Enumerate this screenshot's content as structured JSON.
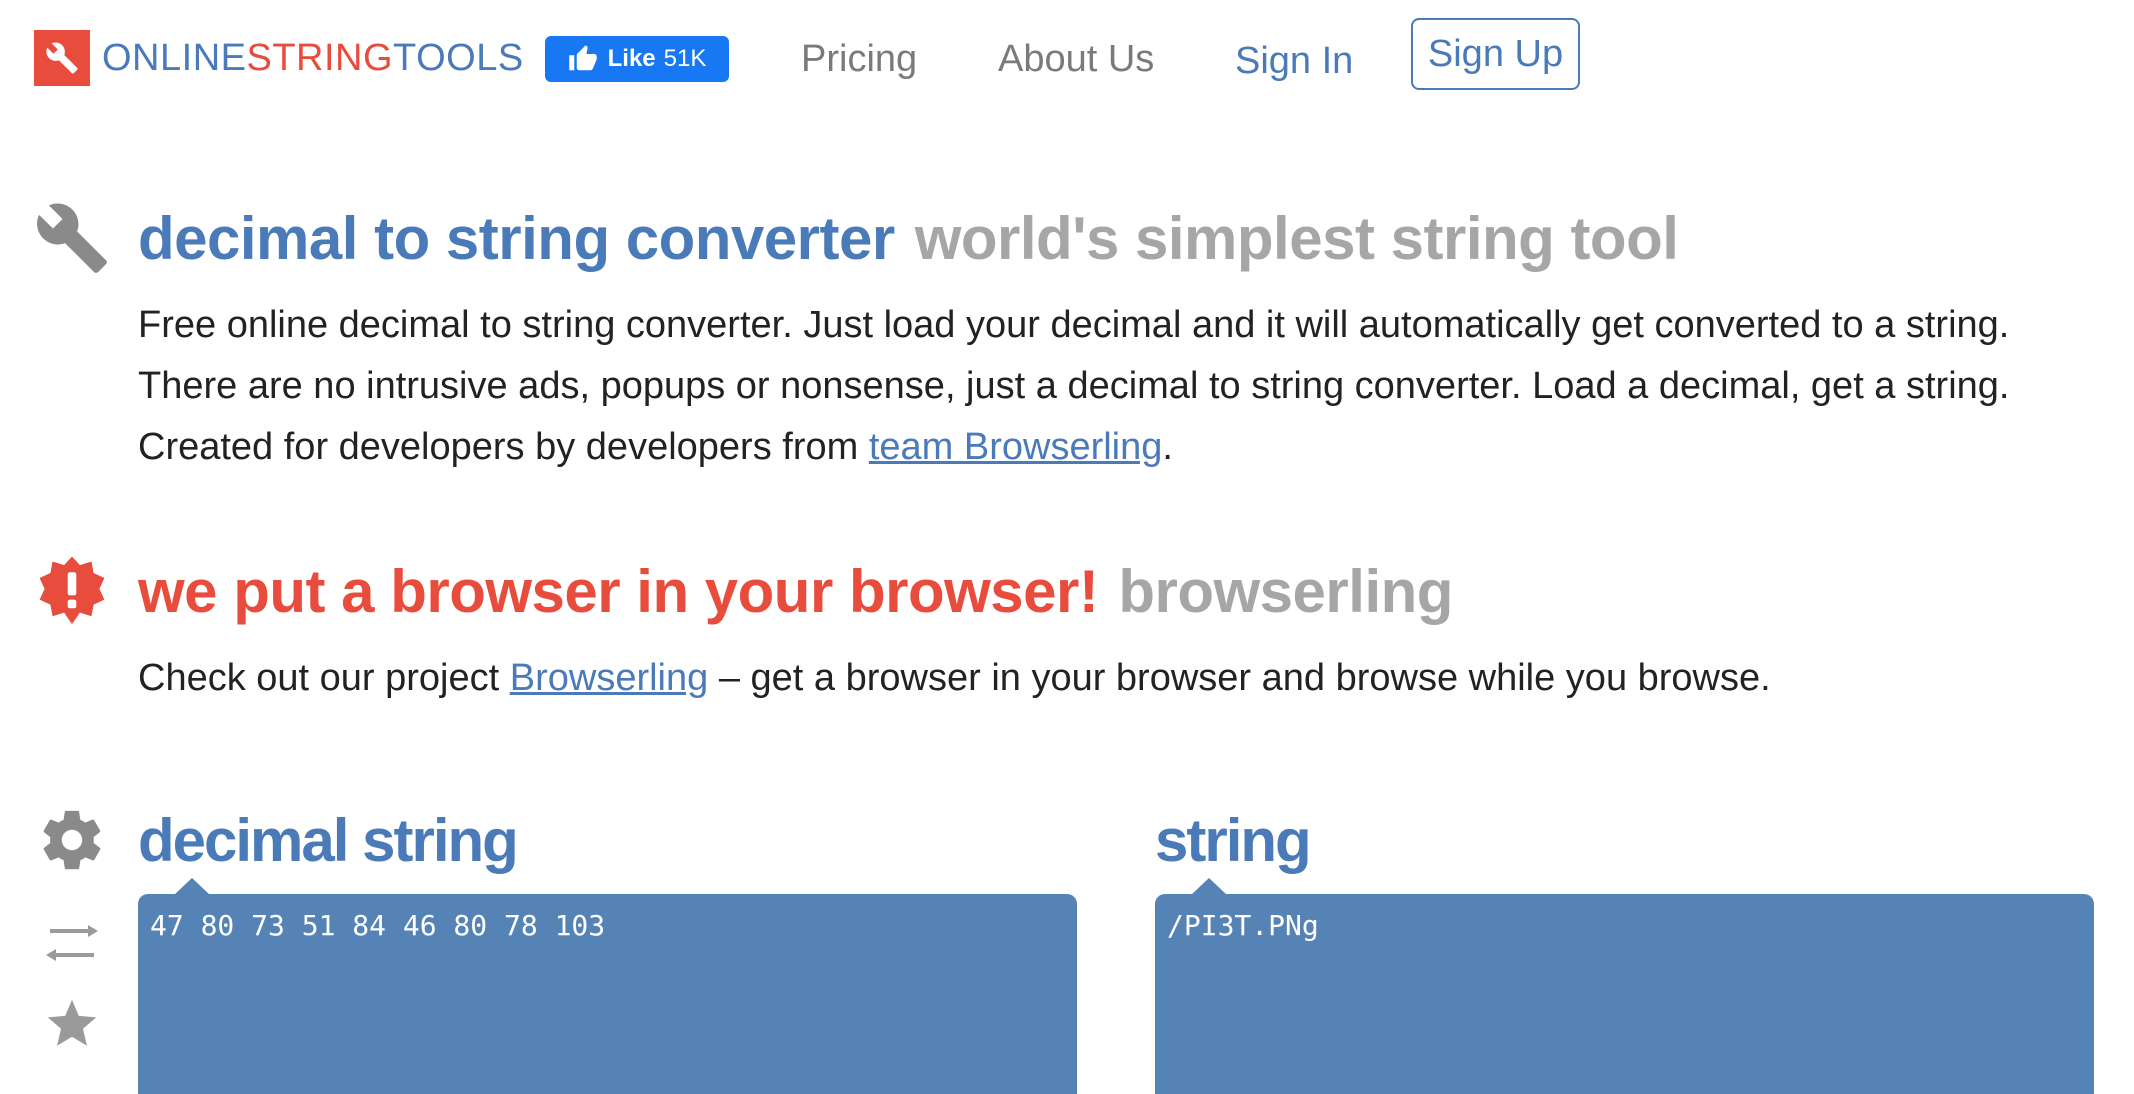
{
  "header": {
    "logo": {
      "part1": "ONLINE",
      "part2": "STRING",
      "part3": "TOOLS"
    },
    "fb_like": {
      "label": "Like",
      "count": "51K"
    },
    "nav": {
      "pricing": "Pricing",
      "about": "About Us",
      "signin": "Sign In",
      "signup": "Sign Up"
    }
  },
  "intro": {
    "title": "decimal to string converter",
    "subtitle": "world's simplest string tool",
    "description_before_link": "Free online decimal to string converter. Just load your decimal and it will automatically get converted to a string. There are no intrusive ads, popups or nonsense, just a decimal to string converter. Load a decimal, get a string. Created for developers by developers from ",
    "link_text": "team Browserling",
    "description_after_link": "."
  },
  "promo": {
    "title": "we put a browser in your browser!",
    "subtitle": "browserling",
    "text_before_link": "Check out our project ",
    "link_text": "Browserling",
    "text_after_link": " – get a browser in your browser and browse while you browse."
  },
  "tool": {
    "input_title": "decimal string",
    "input_value": "47 80 73 51 84 46 80 78 103",
    "output_title": "string",
    "output_value": "/PI3T.PNg"
  },
  "icons": {
    "logo": "wrench-icon",
    "intro": "wrench-icon",
    "promo": "alert-badge-icon",
    "options": "gear-icon",
    "swap": "swap-arrows-icon",
    "favorite": "star-icon",
    "like": "thumbs-up-icon"
  },
  "colors": {
    "brand_blue": "#4a7ab8",
    "brand_red": "#e74c3c",
    "panel_blue": "#5683b5",
    "muted_gray": "#a6a6a6",
    "facebook_blue": "#1877f2"
  }
}
